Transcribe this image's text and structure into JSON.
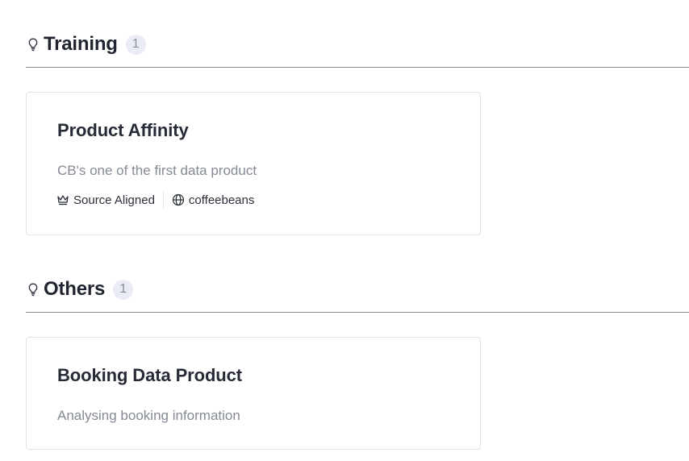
{
  "sections": [
    {
      "title": "Training",
      "count": "1",
      "icon": "lightbulb-icon",
      "cards": [
        {
          "title": "Product Affinity",
          "description": "CB's one of the first data product",
          "type_label": "Source Aligned",
          "type_icon": "crown-icon",
          "domain_label": "coffeebeans",
          "domain_icon": "globe-icon"
        }
      ]
    },
    {
      "title": "Others",
      "count": "1",
      "icon": "lightbulb-icon",
      "cards": [
        {
          "title": "Booking Data Product",
          "description": "Analysing booking information"
        }
      ]
    }
  ]
}
